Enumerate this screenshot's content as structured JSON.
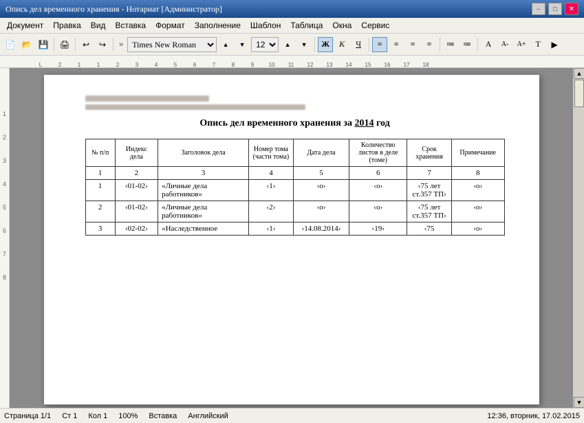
{
  "titlebar": {
    "title": "Опись дел временного хранения - Нотариат [Администратор]",
    "minimize": "–",
    "maximize": "□",
    "close": "✕"
  },
  "menubar": {
    "items": [
      "Документ",
      "Правка",
      "Вид",
      "Вставка",
      "Формат",
      "Заполнение",
      "Шаблон",
      "Таблица",
      "Окна",
      "Сервис"
    ]
  },
  "toolbar": {
    "font_name": "Times New Roman",
    "font_size": "12",
    "bold": "Ж",
    "italic": "К",
    "underline": "Ч"
  },
  "ruler": {
    "marks": [
      "2",
      "1",
      "1",
      "2",
      "3",
      "4",
      "5",
      "6",
      "7",
      "8",
      "9",
      "10",
      "11",
      "12",
      "13",
      "14",
      "15",
      "16",
      "17",
      "18"
    ]
  },
  "document": {
    "title": "Опись дел временного хранения за ",
    "year": "2014",
    "title_end": " год",
    "table": {
      "headers": [
        "№ п/п",
        "Индекс дела",
        "Заголовок дела",
        "Номер тома (части тома)",
        "Дата дела",
        "Количество листов в деле (томе)",
        "Срок хранения",
        "Примечание"
      ],
      "num_row": [
        "1",
        "2",
        "3",
        "4",
        "5",
        "6",
        "7",
        "8"
      ],
      "rows": [
        {
          "num": "1",
          "index": "‹01-02›",
          "title": "«Личные дела работников»",
          "vol": "‹1›",
          "date": "‹о›",
          "sheets": "‹о›",
          "period": "‹75 лет ст.357 ТП›",
          "notes": "‹о›"
        },
        {
          "num": "2",
          "index": "‹01-02›",
          "title": "«Личные дела работников»",
          "vol": "‹2›",
          "date": "‹о›",
          "sheets": "‹о›",
          "period": "‹75 лет ст.357 ТП›",
          "notes": "‹о›"
        },
        {
          "num": "3",
          "index": "‹02-02›",
          "title": "«Наследственное",
          "vol": "‹1›",
          "date": "‹14.08.2014›",
          "sheets": "‹19›",
          "period": "‹75",
          "notes": "‹о›"
        }
      ]
    }
  },
  "statusbar": {
    "page": "Страница 1/1",
    "row": "Ст 1",
    "col": "Кол 1",
    "zoom": "100%",
    "mode": "Вставка",
    "lang": "Английский",
    "time": "12:36, вторник, 17.02.2015"
  }
}
